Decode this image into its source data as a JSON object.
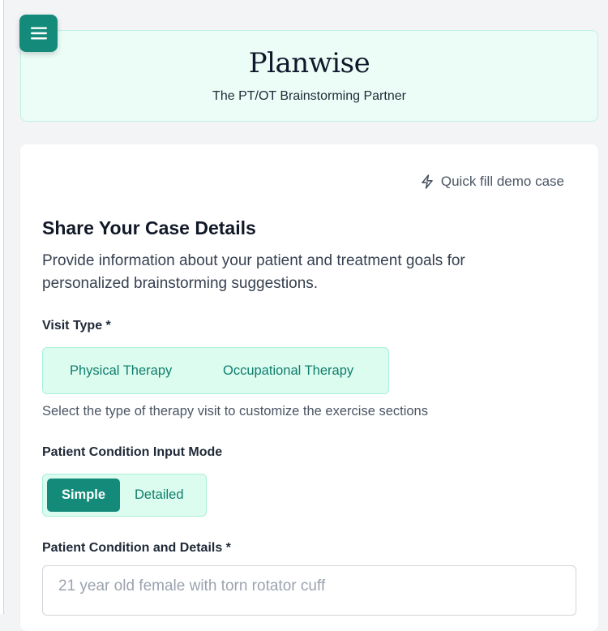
{
  "header": {
    "title": "Planwise",
    "subtitle": "The PT/OT Brainstorming Partner"
  },
  "menu": {
    "icon": "menu-icon"
  },
  "quick_fill": {
    "label": "Quick fill demo case",
    "icon": "lightning-icon"
  },
  "form": {
    "title": "Share Your Case Details",
    "description": "Provide information about your patient and treatment goals for personalized brainstorming suggestions.",
    "visit_type": {
      "label": "Visit Type *",
      "options": [
        "Physical Therapy",
        "Occupational Therapy"
      ],
      "helper": "Select the type of therapy visit to customize the exercise sections"
    },
    "input_mode": {
      "label": "Patient Condition Input Mode",
      "options": [
        "Simple",
        "Detailed"
      ],
      "selected": "Simple"
    },
    "condition": {
      "label": "Patient Condition and Details *",
      "placeholder": "21 year old female with torn rotator cuff",
      "value": ""
    }
  },
  "colors": {
    "accent": "#148b7a",
    "accent_light": "#dcfcef",
    "header_bg": "#ecfdf7"
  }
}
